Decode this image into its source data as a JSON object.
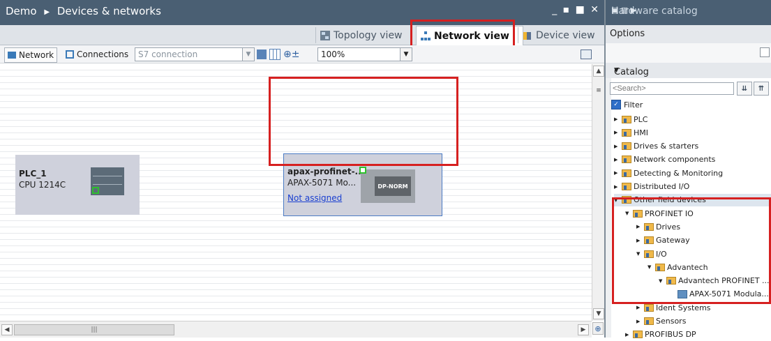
{
  "editor": {
    "breadcrumb": [
      "Demo",
      "Devices & networks"
    ],
    "window_controls": "_ ▪ ■ ✕"
  },
  "tabs": [
    {
      "label": "Topology view",
      "icon": "topology-icon"
    },
    {
      "label": "Network view",
      "icon": "network-icon",
      "active": true
    },
    {
      "label": "Device view",
      "icon": "device-icon"
    }
  ],
  "toolbar": {
    "network_label": "Network",
    "connections_label": "Connections",
    "connection_type": "S7 connection",
    "zoom": "100%"
  },
  "devices": {
    "plc": {
      "name": "PLC_1",
      "type": "CPU 1214C"
    },
    "apax": {
      "name": "apax-profinet-...",
      "type": "APAX-5071 Mo...",
      "assign": "Not assigned",
      "dp_label": "DP-NORM"
    }
  },
  "catalog": {
    "title": "Hardware catalog",
    "options": "Options",
    "catalog_label": "Catalog",
    "search_placeholder": "<Search>",
    "filter_label": "Filter",
    "tree": [
      {
        "label": "PLC",
        "level": 0,
        "expanded": false
      },
      {
        "label": "HMI",
        "level": 0,
        "expanded": false
      },
      {
        "label": "Drives & starters",
        "level": 0,
        "expanded": false
      },
      {
        "label": "Network components",
        "level": 0,
        "expanded": false
      },
      {
        "label": "Detecting & Monitoring",
        "level": 0,
        "expanded": false
      },
      {
        "label": "Distributed I/O",
        "level": 0,
        "expanded": false
      },
      {
        "label": "Other field devices",
        "level": 0,
        "expanded": true,
        "selected": true
      },
      {
        "label": "PROFINET IO",
        "level": 1,
        "expanded": true
      },
      {
        "label": "Drives",
        "level": 2,
        "expanded": false
      },
      {
        "label": "Gateway",
        "level": 2,
        "expanded": false
      },
      {
        "label": "I/O",
        "level": 2,
        "expanded": true
      },
      {
        "label": "Advantech",
        "level": 3,
        "expanded": true
      },
      {
        "label": "Advantech PROFINET ...",
        "level": 4,
        "expanded": true
      },
      {
        "label": "APAX-5071 Modula...",
        "level": 5,
        "leaf": true
      },
      {
        "label": "Ident Systems",
        "level": 2,
        "expanded": false
      },
      {
        "label": "Sensors",
        "level": 2,
        "expanded": false
      },
      {
        "label": "PROFIBUS DP",
        "level": 1,
        "expanded": false
      }
    ]
  }
}
